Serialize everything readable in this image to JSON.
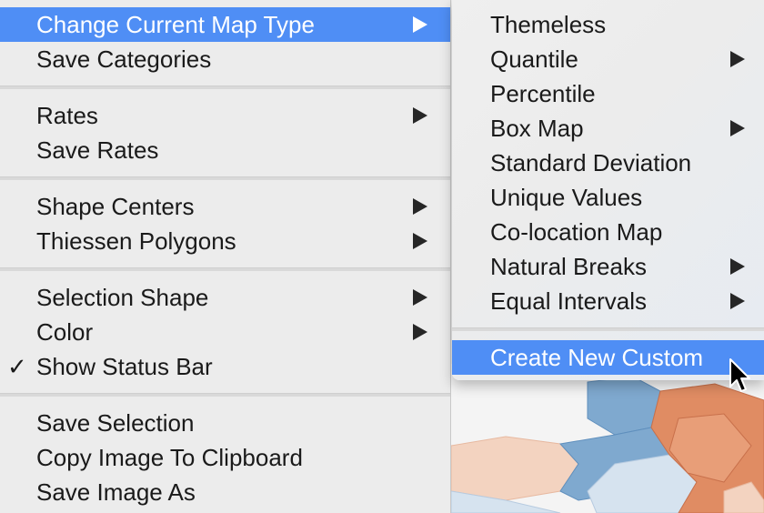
{
  "main_menu": {
    "groups": [
      [
        {
          "label": "Change Current Map Type",
          "has_submenu": true,
          "highlighted": true
        },
        {
          "label": "Save Categories",
          "has_submenu": false
        }
      ],
      [
        {
          "label": "Rates",
          "has_submenu": true
        },
        {
          "label": "Save Rates",
          "has_submenu": false
        }
      ],
      [
        {
          "label": "Shape Centers",
          "has_submenu": true
        },
        {
          "label": "Thiessen Polygons",
          "has_submenu": true
        }
      ],
      [
        {
          "label": "Selection Shape",
          "has_submenu": true
        },
        {
          "label": "Color",
          "has_submenu": true
        },
        {
          "label": "Show Status Bar",
          "has_submenu": false,
          "checked": true,
          "check_glyph": "✓"
        }
      ],
      [
        {
          "label": "Save Selection",
          "has_submenu": false
        },
        {
          "label": "Copy Image To Clipboard",
          "has_submenu": false
        },
        {
          "label": "Save Image As",
          "has_submenu": false
        }
      ]
    ]
  },
  "submenu": {
    "items": [
      {
        "label": "Themeless",
        "has_submenu": false
      },
      {
        "label": "Quantile",
        "has_submenu": true
      },
      {
        "label": "Percentile",
        "has_submenu": false
      },
      {
        "label": "Box Map",
        "has_submenu": true
      },
      {
        "label": "Standard Deviation",
        "has_submenu": false
      },
      {
        "label": "Unique Values",
        "has_submenu": false
      },
      {
        "label": "Co-location Map",
        "has_submenu": false
      },
      {
        "label": "Natural Breaks",
        "has_submenu": true
      },
      {
        "label": "Equal Intervals",
        "has_submenu": true
      }
    ],
    "footer_item": {
      "label": "Create New Custom",
      "has_submenu": false,
      "highlighted": true
    }
  },
  "colors": {
    "highlight": "#4f8ef5",
    "menu_bg": "#ececec",
    "map_blue": "#7fa9cf",
    "map_orange": "#e08c63",
    "map_peach": "#f3d3c0"
  },
  "icons": {
    "submenu_arrow": "chevron-right-icon",
    "checkmark": "check-icon",
    "pointer": "mouse-pointer-icon"
  }
}
